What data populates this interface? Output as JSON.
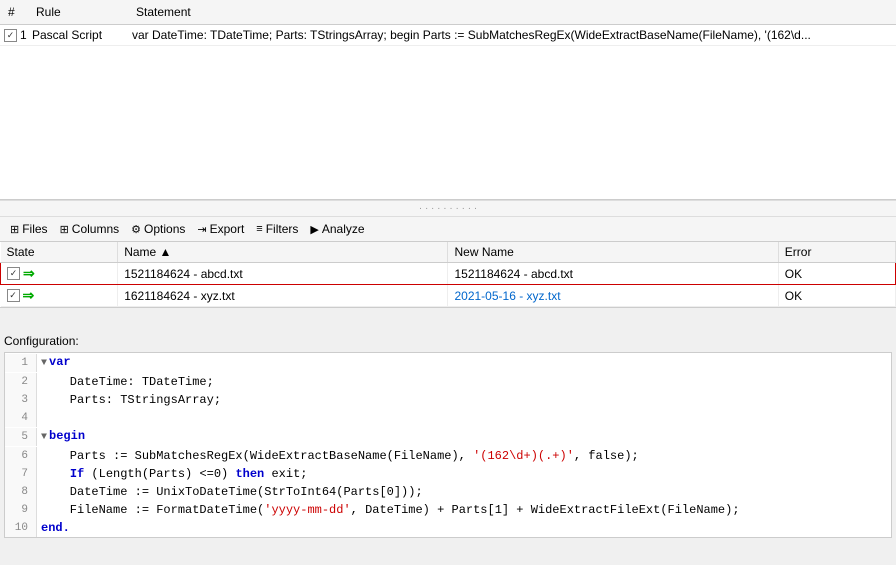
{
  "rules": {
    "headers": [
      "#",
      "Rule",
      "Statement"
    ],
    "rows": [
      {
        "number": "1",
        "checked": true,
        "rule": "Pascal Script",
        "statement": "var DateTime: TDateTime; Parts: TStringsArray; begin Parts := SubMatchesRegEx(WideExtractBaseName(FileName), '(162\\d..."
      }
    ]
  },
  "toolbar": {
    "buttons": [
      {
        "label": "Files",
        "icon": "⊞"
      },
      {
        "label": "Columns",
        "icon": "⊞"
      },
      {
        "label": "Options",
        "icon": "⚙"
      },
      {
        "label": "Export",
        "icon": "⇥"
      },
      {
        "label": "Filters",
        "icon": "≡"
      },
      {
        "label": "Analyze",
        "icon": "▶"
      }
    ]
  },
  "files_table": {
    "headers": [
      "State",
      "Name",
      "New Name",
      "Error"
    ],
    "rows": [
      {
        "checked": true,
        "name": "1521184624 - abcd.txt",
        "new_name": "1521184624 - abcd.txt",
        "error": "OK",
        "highlighted": true,
        "new_name_is_link": false
      },
      {
        "checked": true,
        "name": "1621184624 - xyz.txt",
        "new_name": "2021-05-16 - xyz.txt",
        "error": "OK",
        "highlighted": false,
        "new_name_is_link": true
      }
    ]
  },
  "configuration": {
    "label": "Configuration:",
    "lines": [
      {
        "num": 1,
        "fold": "▼",
        "content": "var",
        "type": "keyword"
      },
      {
        "num": 2,
        "fold": "",
        "content": "    DateTime: TDateTime;",
        "type": "normal"
      },
      {
        "num": 3,
        "fold": "",
        "content": "    Parts: TStringsArray;",
        "type": "normal"
      },
      {
        "num": 4,
        "fold": "",
        "content": "",
        "type": "normal"
      },
      {
        "num": 5,
        "fold": "▼",
        "content": "begin",
        "type": "keyword"
      },
      {
        "num": 6,
        "fold": "",
        "content": "    Parts := SubMatchesRegEx(WideExtractBaseName(FileName), '(162\\d+)(.+)', false);",
        "type": "normal"
      },
      {
        "num": 7,
        "fold": "",
        "content": "    If (Length(Parts) <=0) then exit;",
        "type": "normal"
      },
      {
        "num": 8,
        "fold": "",
        "content": "    DateTime := UnixToDateTime(StrToInt64(Parts[0]));",
        "type": "normal"
      },
      {
        "num": 9,
        "fold": "",
        "content": "    FileName := FormatDateTime('yyyy-mm-dd', DateTime) + Parts[1] + WideExtractFileExt(FileName);",
        "type": "normal"
      },
      {
        "num": 10,
        "fold": "",
        "content": "end.",
        "type": "keyword"
      }
    ]
  }
}
